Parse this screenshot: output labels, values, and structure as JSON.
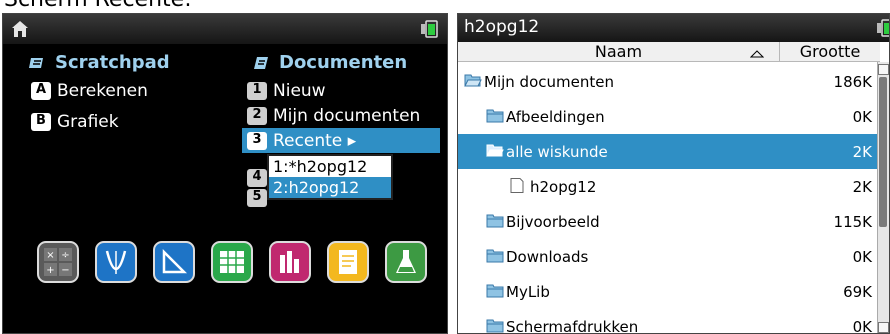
{
  "caption": "Scherm Recente:",
  "left": {
    "scratchpad_title": "Scratchpad",
    "scratchpad_items": [
      {
        "key": "A",
        "label": "Berekenen"
      },
      {
        "key": "B",
        "label": "Grafiek"
      }
    ],
    "documents_title": "Documenten",
    "documents_items": [
      {
        "key": "1",
        "label": "Nieuw"
      },
      {
        "key": "2",
        "label": "Mijn documenten"
      },
      {
        "key": "3",
        "label": "Recente ▸"
      }
    ],
    "recent_submenu": [
      "1:*h2opg12",
      "2:h2opg12"
    ],
    "hidden_keys": [
      "4",
      "5"
    ],
    "apps": [
      "calculator-app",
      "graphs-app",
      "geometry-app",
      "lists-app",
      "data-app",
      "notes-app",
      "vernier-app"
    ],
    "colors": {
      "accent": "#2f8fc5",
      "header_text": "#9fd1ee"
    }
  },
  "right": {
    "title": "h2opg12",
    "columns": {
      "name": "Naam",
      "size": "Grootte"
    },
    "rows": [
      {
        "name": "Mijn documenten",
        "size": "186K",
        "icon": "folder-open-icon",
        "selected": false
      },
      {
        "name": "Afbeeldingen",
        "size": "0K",
        "icon": "folder-icon",
        "selected": false
      },
      {
        "name": "alle wiskunde",
        "size": "2K",
        "icon": "folder-open-icon",
        "selected": true
      },
      {
        "name": "h2opg12",
        "size": "2K",
        "icon": "document-icon",
        "selected": false
      },
      {
        "name": "Bijvoorbeeld",
        "size": "115K",
        "icon": "folder-icon",
        "selected": false
      },
      {
        "name": "Downloads",
        "size": "0K",
        "icon": "folder-icon",
        "selected": false
      },
      {
        "name": "MyLib",
        "size": "69K",
        "icon": "folder-icon",
        "selected": false
      },
      {
        "name": "Schermafdrukken",
        "size": "0K",
        "icon": "folder-icon",
        "selected": false
      }
    ]
  }
}
